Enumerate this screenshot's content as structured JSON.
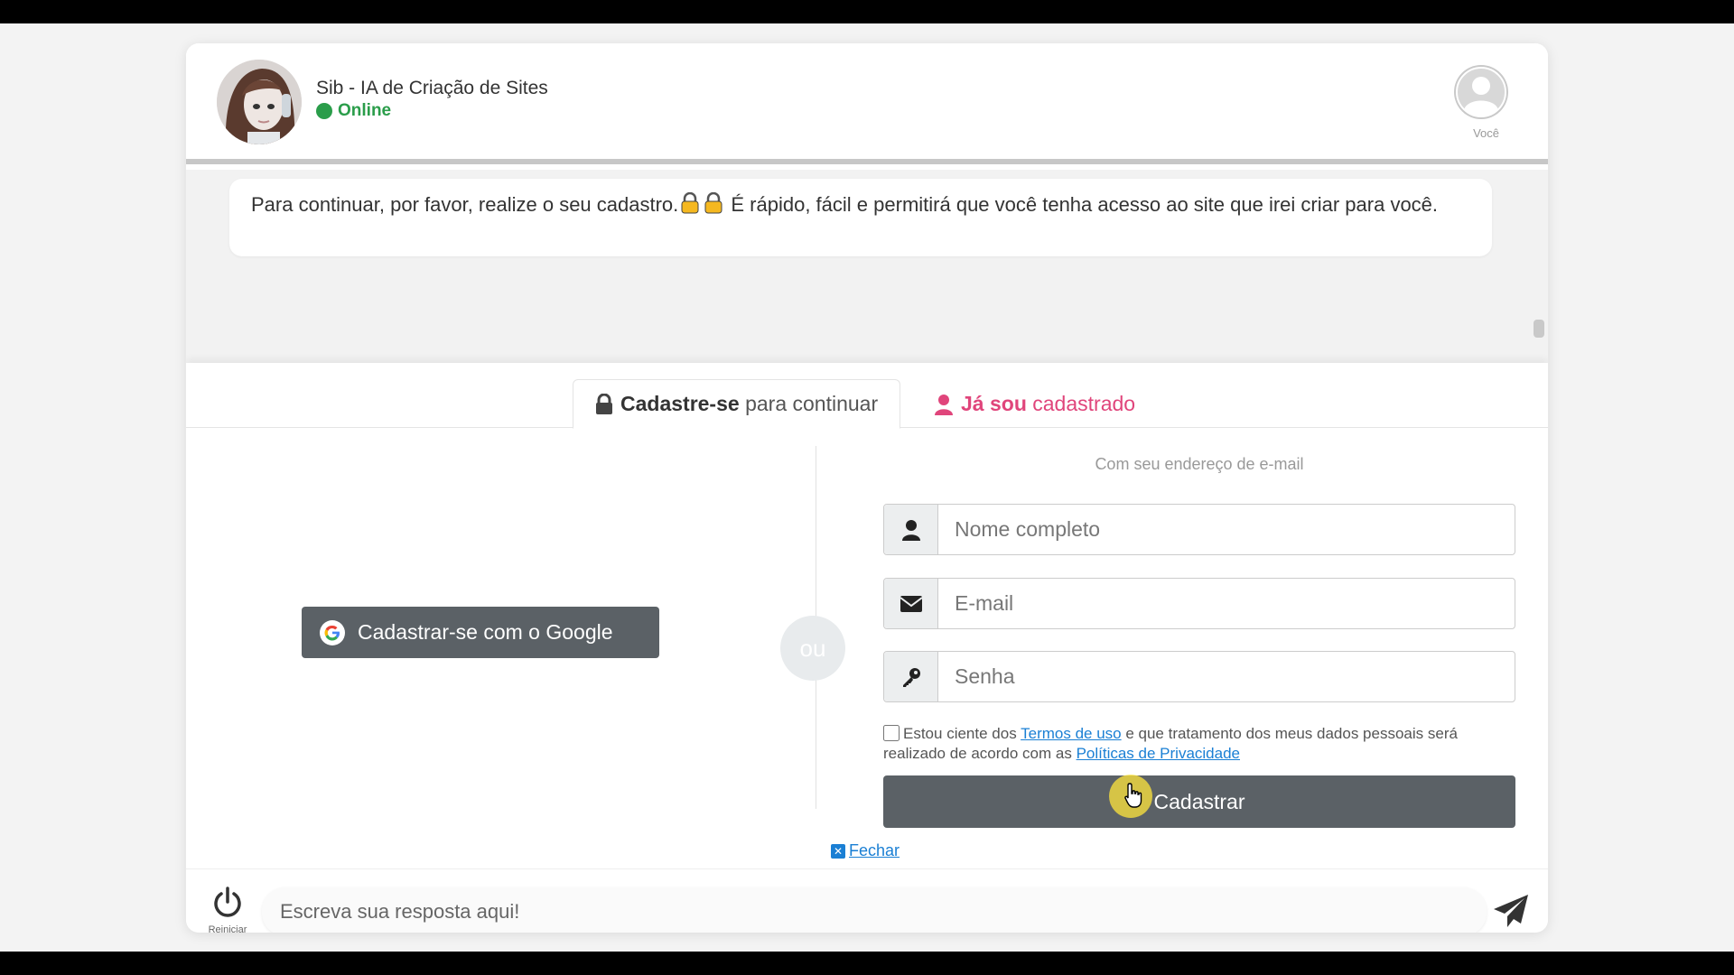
{
  "header": {
    "bot_name": "Sib - IA de Criação de Sites",
    "status": "Online",
    "user_label": "Você"
  },
  "chat": {
    "message_part1": "Para continuar, por favor, realize o seu cadastro.",
    "message_part2": " É rápido, fácil e permitirá que você tenha acesso ao site que irei criar para você."
  },
  "tabs": {
    "signup_bold": "Cadastre-se",
    "signup_rest": " para continuar",
    "login_bold": "Já sou",
    "login_rest": " cadastrado"
  },
  "form": {
    "google_button": "Cadastrar-se com o Google",
    "or_label": "ou",
    "email_hint": "Com seu endereço de e-mail",
    "name_placeholder": "Nome completo",
    "email_placeholder": "E-mail",
    "password_placeholder": "Senha",
    "terms_prefix": "Estou ciente dos ",
    "terms_link": "Termos de uso",
    "terms_middle": " e que tratamento dos meus dados pessoais será realizado de acordo com as ",
    "privacy_link": "Políticas de Privacidade",
    "submit_label": "Cadastrar",
    "close_label": "Fechar"
  },
  "footer": {
    "restart_label": "Reiniciar",
    "reply_placeholder": "Escreva sua resposta aqui!"
  },
  "colors": {
    "online": "#2a9d4a",
    "accent_pink": "#e0457b",
    "link": "#1a7fd4",
    "button_dark": "#5b6166"
  }
}
